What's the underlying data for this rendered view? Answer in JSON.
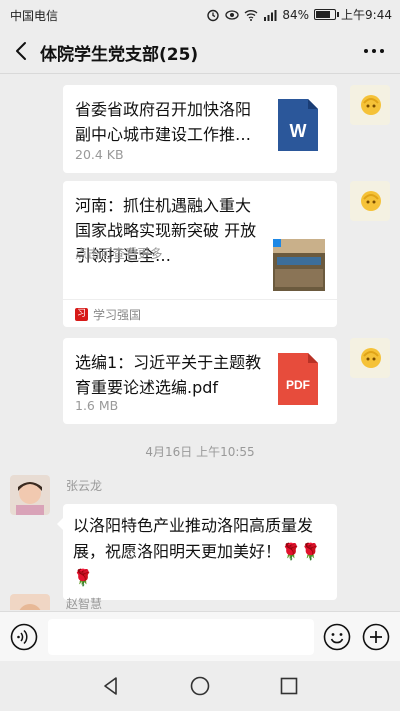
{
  "status_bar": {
    "carrier": "中国电信",
    "battery": "84%",
    "battery_level": 0.84,
    "time": "上午9:44"
  },
  "header": {
    "title": "体院学生党支部(25)"
  },
  "messages": {
    "file1": {
      "title": "省委省政府召开加快洛阳副中心城市建设工作推…",
      "size": "20.4 KB",
      "icon_label": "W"
    },
    "article": {
      "title": "河南：抓住机遇融入重大国家战略实现新突破 开放引领打造全…",
      "hint": "点击可查看更多",
      "source": "学习强国",
      "source_icon": "习"
    },
    "file2": {
      "title": "选编1：习近平关于主题教育重要论述选编.pdf",
      "size": "1.6 MB",
      "icon_label": "PDF"
    },
    "timestamp": "4月16日 上午10:55",
    "msg1": {
      "sender": "张云龙",
      "text": "以洛阳特色产业推动洛阳高质量发展，祝愿洛阳明天更加美好！🌹🌹🌹"
    },
    "msg2": {
      "sender": "赵智慧"
    }
  },
  "colors": {
    "word": "#2b579a",
    "pdf": "#e74c3c",
    "background": "#ededed",
    "bubble": "#ffffff"
  }
}
